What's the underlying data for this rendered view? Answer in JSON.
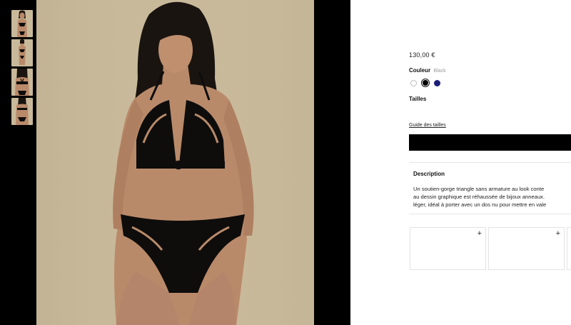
{
  "product": {
    "price": "130,00 €",
    "color_label": "Couleur",
    "color_value": "Black",
    "swatches": [
      "white",
      "black",
      "navy"
    ],
    "sizes_label": "Tailles",
    "size_guide_label": "Guide des tailles",
    "add_to_cart_label": ""
  },
  "description": {
    "title": "Description",
    "lines": [
      "Un soutien-gorge triangle sans armature au look conte",
      "au dessin graphique est réhaussée de bijoux anneaux.",
      "léger, idéal à porter avec un dos nu pour mettre en vale"
    ]
  },
  "cards": [
    {
      "plus": "+"
    },
    {
      "plus": "+"
    },
    {
      "plus": ""
    }
  ],
  "colors": {
    "background_left": "#000000",
    "photo_backdrop": "#c8b99a",
    "lingerie": "#0e0d0c",
    "skin": "#b98a6a",
    "navy_swatch": "#1c1d7a"
  },
  "icons": {
    "card_plus": "plus-icon"
  }
}
